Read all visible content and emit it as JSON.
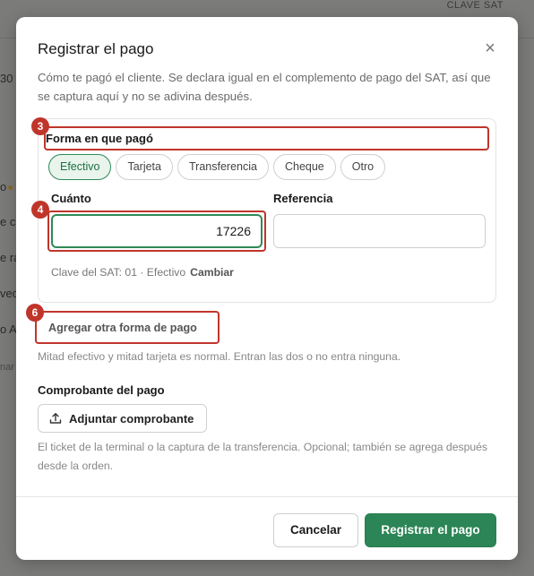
{
  "background": {
    "header": "CLAVE SAT",
    "fragments": [
      "30",
      "o",
      "e co",
      "e ra",
      "vec",
      "o Av",
      "nar"
    ]
  },
  "modal": {
    "title": "Registrar el pago",
    "close_icon": "close-icon",
    "description": "Cómo te pagó el cliente. Se declara igual en el complemento de pago del SAT, así que se captura aquí y no se adivina después."
  },
  "payment": {
    "method_label": "Forma en que pagó",
    "methods": [
      "Efectivo",
      "Tarjeta",
      "Transferencia",
      "Cheque",
      "Otro"
    ],
    "selected_method": "Efectivo",
    "amount_label": "Cuánto",
    "amount_value": "17226",
    "reference_label": "Referencia",
    "reference_value": "",
    "sat_key_text": "Clave del SAT: 01 · Efectivo",
    "sat_change": "Cambiar"
  },
  "badges": {
    "method": "3",
    "amount": "4",
    "add": "6"
  },
  "add_payment_link": "Agregar otra forma de pago",
  "split_hint": "Mitad efectivo y mitad tarjeta es normal. Entran las dos o no entra ninguna.",
  "proof": {
    "label": "Comprobante del pago",
    "attach_button": "Adjuntar comprobante",
    "attach_icon": "upload-icon",
    "hint": "El ticket de la terminal o la captura de la transferencia. Opcional; también se agrega después desde la orden."
  },
  "footer": {
    "cancel": "Cancelar",
    "submit": "Registrar el pago"
  },
  "colors": {
    "accent": "#2b8556",
    "highlight": "#c0352b"
  }
}
